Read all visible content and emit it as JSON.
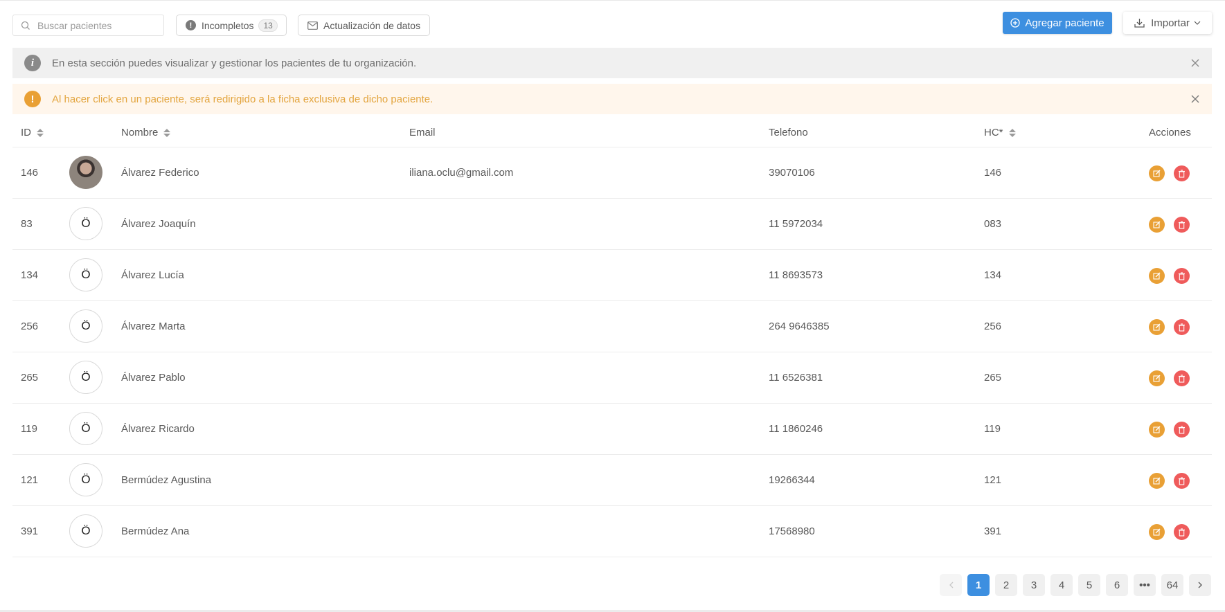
{
  "toolbar": {
    "search_placeholder": "Buscar pacientes",
    "incomplete_label": "Incompletos",
    "incomplete_count": "13",
    "update_label": "Actualización de datos",
    "add_label": "Agregar paciente",
    "import_label": "Importar"
  },
  "alerts": {
    "info_text": "En esta sección puedes visualizar y gestionar los pacientes de tu organización.",
    "warning_text": "Al hacer click en un paciente, será redirigido a la ficha exclusiva de dicho paciente."
  },
  "table": {
    "columns": {
      "id": "ID",
      "name": "Nombre",
      "email": "Email",
      "phone": "Telefono",
      "hc": "HC*",
      "actions": "Acciones"
    },
    "rows": [
      {
        "id": "146",
        "avatar": "",
        "name": "Álvarez Federico",
        "email": "iliana.oclu@gmail.com",
        "phone": "39070106",
        "hc": "146"
      },
      {
        "id": "83",
        "avatar": "Ö",
        "name": "Álvarez Joaquín",
        "email": "",
        "phone": "11 5972034",
        "hc": "083"
      },
      {
        "id": "134",
        "avatar": "Ö",
        "name": "Álvarez Lucía",
        "email": "",
        "phone": "11 8693573",
        "hc": "134"
      },
      {
        "id": "256",
        "avatar": "Ö",
        "name": "Álvarez Marta",
        "email": "",
        "phone": "264 9646385",
        "hc": "256"
      },
      {
        "id": "265",
        "avatar": "Ö",
        "name": "Álvarez Pablo",
        "email": "",
        "phone": "11 6526381",
        "hc": "265"
      },
      {
        "id": "119",
        "avatar": "Ö",
        "name": "Álvarez Ricardo",
        "email": "",
        "phone": "11 1860246",
        "hc": "119"
      },
      {
        "id": "121",
        "avatar": "Ö",
        "name": "Bermúdez Agustina",
        "email": "",
        "phone": "19266344",
        "hc": "121"
      },
      {
        "id": "391",
        "avatar": "Ö",
        "name": "Bermúdez Ana",
        "email": "",
        "phone": "17568980",
        "hc": "391"
      }
    ]
  },
  "pagination": {
    "pages": [
      "1",
      "2",
      "3",
      "4",
      "5",
      "6",
      "•••",
      "64"
    ],
    "current": "1"
  },
  "colors": {
    "primary": "#3d8fe0",
    "warning": "#e9a035",
    "danger": "#ef5b5b",
    "info_bg": "#f0f0f0",
    "warning_bg": "#fff6ec"
  },
  "icons": {
    "search": "search-icon",
    "incomplete": "exclamation-icon",
    "update": "envelope-icon",
    "add": "plus-circle-icon",
    "import": "download-icon",
    "info": "info-icon",
    "warning": "exclamation-icon",
    "close": "close-icon",
    "edit": "edit-icon",
    "delete": "trash-icon"
  }
}
